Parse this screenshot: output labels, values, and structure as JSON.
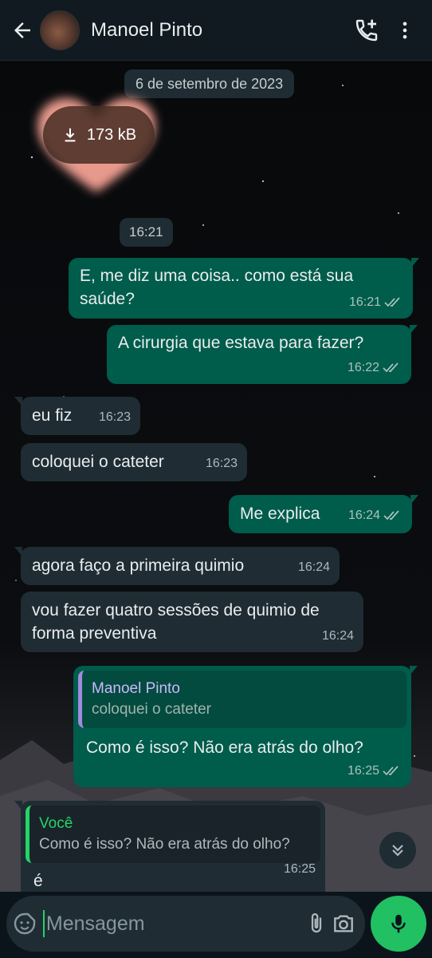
{
  "header": {
    "contact_name": "Manoel Pinto"
  },
  "chat": {
    "date_chip": "6 de setembro de 2023",
    "media": {
      "size": "173 kB"
    },
    "time_chip": "16:21",
    "messages": [
      {
        "dir": "out",
        "text": "E, me diz uma coisa.. como está sua saúde?",
        "time": "16:21",
        "status": "read"
      },
      {
        "dir": "out",
        "text": "A cirurgia que estava para fazer?",
        "time": "16:22",
        "status": "read"
      },
      {
        "dir": "in",
        "text": "eu fiz",
        "time": "16:23"
      },
      {
        "dir": "in",
        "text": "coloquei o cateter",
        "time": "16:23"
      },
      {
        "dir": "out",
        "text": "Me explica",
        "time": "16:24",
        "status": "read"
      },
      {
        "dir": "in",
        "text": "agora faço a primeira quimio",
        "time": "16:24"
      },
      {
        "dir": "in",
        "text": "vou fazer quatro sessões de quimio de forma preventiva",
        "time": "16:24"
      },
      {
        "dir": "out",
        "quote_name": "Manoel Pinto",
        "quote_text": "coloquei o cateter",
        "text": "Como é isso? Não era atrás do olho?",
        "time": "16:25",
        "status": "read"
      },
      {
        "dir": "in",
        "quote_name": "Você",
        "quote_text": "Como é isso? Não era atrás do olho?",
        "text": "é",
        "time": "16:25"
      }
    ]
  },
  "composer": {
    "placeholder": "Mensagem"
  },
  "colors": {
    "outgoing": "#005c4b",
    "incoming": "#1f2c33",
    "accent": "#21c063"
  }
}
